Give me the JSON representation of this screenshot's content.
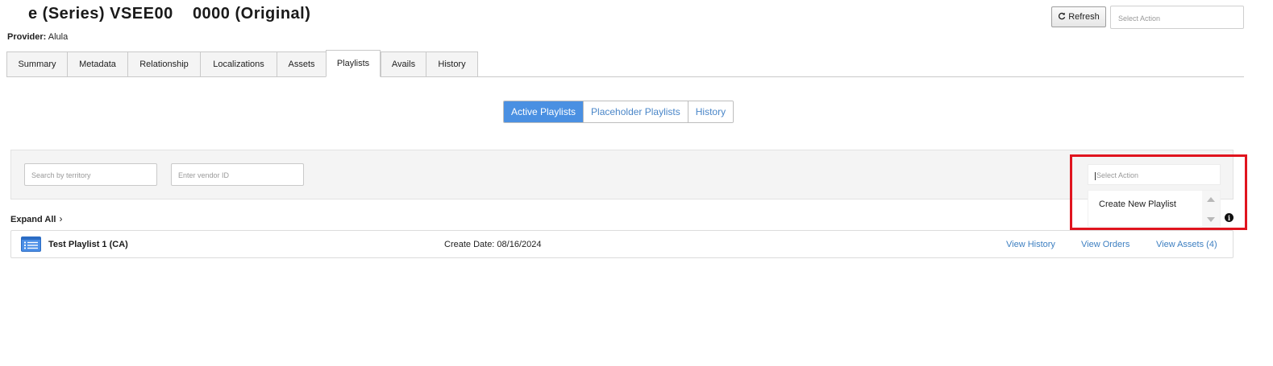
{
  "header": {
    "title": "e (Series) VSEE00    0000 (Original)",
    "provider_label": "Provider:",
    "provider_value": "Alula",
    "refresh_icon": "refresh-icon",
    "refresh_label": "Refresh",
    "select_action_placeholder": "Select Action"
  },
  "tabs": [
    {
      "label": "Summary"
    },
    {
      "label": "Metadata"
    },
    {
      "label": "Relationship"
    },
    {
      "label": "Localizations"
    },
    {
      "label": "Assets"
    },
    {
      "label": "Playlists",
      "active": true
    },
    {
      "label": "Avails"
    },
    {
      "label": "History"
    }
  ],
  "segments": [
    {
      "label": "Active Playlists",
      "active": true
    },
    {
      "label": "Placeholder Playlists"
    },
    {
      "label": "History"
    }
  ],
  "filters": {
    "territory_placeholder": "Search by territory",
    "vendor_placeholder": "Enter vendor ID",
    "action_placeholder": "Select Action",
    "action_options": [
      "Create New Playlist"
    ]
  },
  "list": {
    "expand_all": "Expand All",
    "rows": [
      {
        "icon": "list-icon",
        "name": "Test Playlist 1 (CA)",
        "create_date": "Create Date: 08/16/2024",
        "links": [
          "View History",
          "View Orders",
          "View Assets (4)"
        ]
      }
    ]
  },
  "colors": {
    "accent": "#4a90e2",
    "link": "#3d7fc1",
    "highlight": "#e0141e"
  }
}
